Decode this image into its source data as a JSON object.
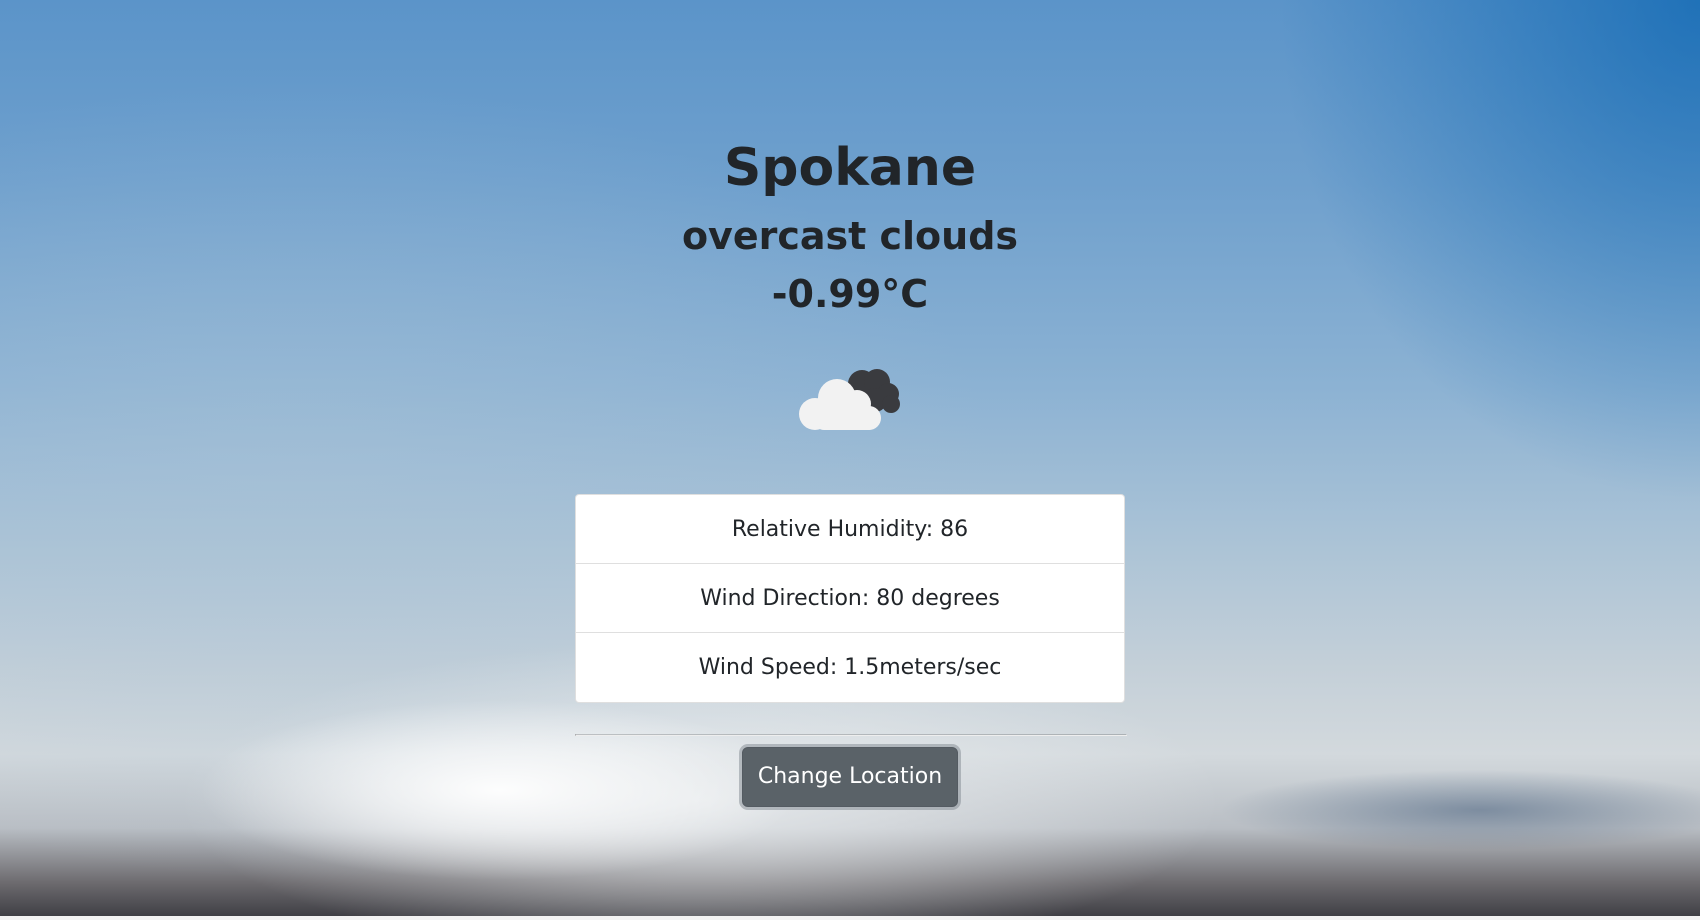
{
  "location": {
    "city": "Spokane",
    "description": "overcast clouds",
    "temperature": "-0.99°C"
  },
  "icon": {
    "name": "overcast-clouds-icon"
  },
  "details": [
    {
      "label": "Relative Humidity: 86"
    },
    {
      "label": "Wind Direction: 80 degrees"
    },
    {
      "label": "Wind Speed: 1.5meters/sec"
    }
  ],
  "actions": {
    "change_location_label": "Change Location"
  },
  "colors": {
    "text": "#212529",
    "button_bg": "#5a6268",
    "button_text": "#ffffff",
    "card_bg": "#ffffff"
  }
}
